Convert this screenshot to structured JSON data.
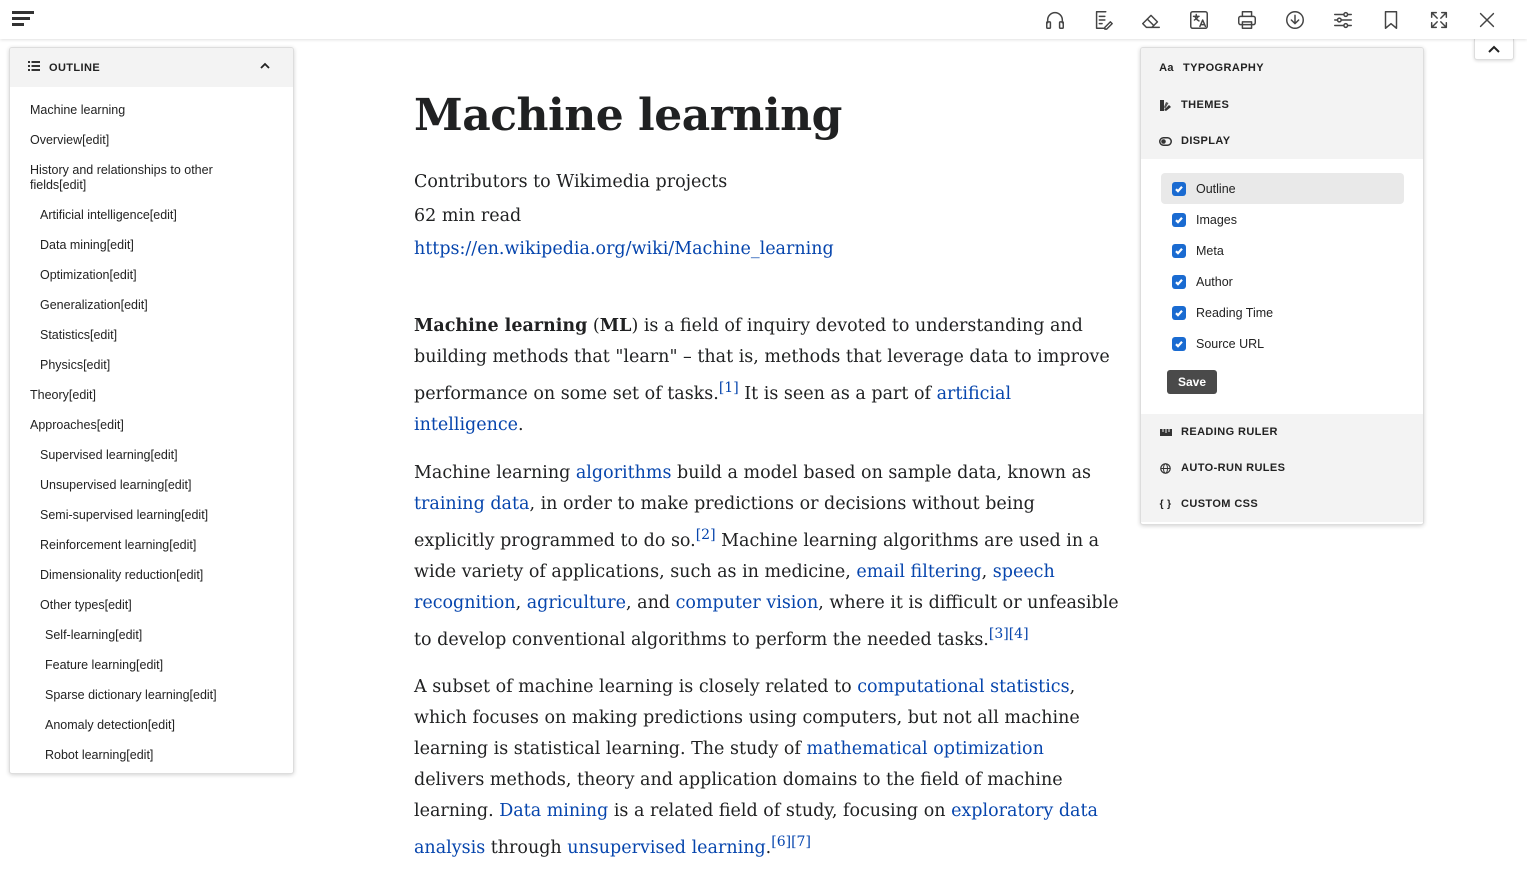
{
  "toolbar": {
    "icons": [
      "headphones-icon",
      "edit-notes-icon",
      "eraser-icon",
      "translate-icon",
      "print-icon",
      "download-icon",
      "sliders-icon",
      "bookmark-icon",
      "fullscreen-icon",
      "close-icon"
    ]
  },
  "outline": {
    "title": "OUTLINE",
    "items": [
      {
        "label": "Machine learning",
        "level": 1
      },
      {
        "label": "Overview[edit]",
        "level": 1
      },
      {
        "label": "History and relationships to other fields[edit]",
        "level": 1
      },
      {
        "label": "Artificial intelligence[edit]",
        "level": 2
      },
      {
        "label": "Data mining[edit]",
        "level": 2
      },
      {
        "label": "Optimization[edit]",
        "level": 2
      },
      {
        "label": "Generalization[edit]",
        "level": 2
      },
      {
        "label": "Statistics[edit]",
        "level": 2
      },
      {
        "label": "Physics[edit]",
        "level": 2
      },
      {
        "label": "Theory[edit]",
        "level": 1
      },
      {
        "label": "Approaches[edit]",
        "level": 1
      },
      {
        "label": "Supervised learning[edit]",
        "level": 2
      },
      {
        "label": "Unsupervised learning[edit]",
        "level": 2
      },
      {
        "label": "Semi-supervised learning[edit]",
        "level": 2
      },
      {
        "label": "Reinforcement learning[edit]",
        "level": 2
      },
      {
        "label": "Dimensionality reduction[edit]",
        "level": 2
      },
      {
        "label": "Other types[edit]",
        "level": 2
      },
      {
        "label": "Self-learning[edit]",
        "level": 3
      },
      {
        "label": "Feature learning[edit]",
        "level": 3
      },
      {
        "label": "Sparse dictionary learning[edit]",
        "level": 3
      },
      {
        "label": "Anomaly detection[edit]",
        "level": 3
      },
      {
        "label": "Robot learning[edit]",
        "level": 3
      }
    ]
  },
  "article": {
    "title": "Machine learning",
    "author": "Contributors to Wikimedia projects",
    "reading_time": "62 min read",
    "source_url": "https://en.wikipedia.org/wiki/Machine_learning",
    "link_color": "#0645ad",
    "paragraphs": [
      [
        {
          "b": "Machine learning"
        },
        {
          "t": " ("
        },
        {
          "b": "ML"
        },
        {
          "t": ") is a field of inquiry devoted to understanding and building methods that \"learn\" – that is, methods that leverage data to improve performance on some set of tasks."
        },
        {
          "s": "[1]"
        },
        {
          "t": " It is seen as a part of "
        },
        {
          "a": "artificial intelligence"
        },
        {
          "t": "."
        }
      ],
      [
        {
          "t": "Machine learning "
        },
        {
          "a": "algorithms"
        },
        {
          "t": " build a model based on sample data, known as "
        },
        {
          "a": "training data"
        },
        {
          "t": ", in order to make predictions or decisions without being explicitly programmed to do so."
        },
        {
          "s": "[2]"
        },
        {
          "t": " Machine learning algorithms are used in a wide variety of applications, such as in medicine, "
        },
        {
          "a": "email filtering"
        },
        {
          "t": ", "
        },
        {
          "a": "speech recognition"
        },
        {
          "t": ", "
        },
        {
          "a": "agriculture"
        },
        {
          "t": ", and "
        },
        {
          "a": "computer vision"
        },
        {
          "t": ", where it is difficult or unfeasible to develop conventional algorithms to perform the needed tasks."
        },
        {
          "s": "[3]"
        },
        {
          "s": "[4]"
        }
      ],
      [
        {
          "t": "A subset of machine learning is closely related to "
        },
        {
          "a": "computational statistics"
        },
        {
          "t": ", which focuses on making predictions using computers, but not all machine learning is statistical learning. The study of "
        },
        {
          "a": "mathematical optimization"
        },
        {
          "t": " delivers methods, theory and application domains to the field of machine learning. "
        },
        {
          "a": "Data mining"
        },
        {
          "t": " is a related field of study, focusing on "
        },
        {
          "a": "exploratory data analysis"
        },
        {
          "t": " through "
        },
        {
          "a": "unsupervised learning"
        },
        {
          "t": "."
        },
        {
          "s": "[6]"
        },
        {
          "s": "[7]"
        }
      ]
    ]
  },
  "settings": {
    "typography": "TYPOGRAPHY",
    "typography_icon_text": "Aa",
    "themes": "THEMES",
    "display": "DISPLAY",
    "display_options": [
      {
        "label": "Outline",
        "checked": true
      },
      {
        "label": "Images",
        "checked": true
      },
      {
        "label": "Meta",
        "checked": true
      },
      {
        "label": "Author",
        "checked": true
      },
      {
        "label": "Reading Time",
        "checked": true
      },
      {
        "label": "Source URL",
        "checked": true
      }
    ],
    "save": "Save",
    "reading_ruler": "READING RULER",
    "auto_run_rules": "AUTO-RUN RULES",
    "custom_css": "CUSTOM CSS",
    "custom_css_icon_text": "{ }",
    "checkbox_color": "#1a6bd1"
  }
}
